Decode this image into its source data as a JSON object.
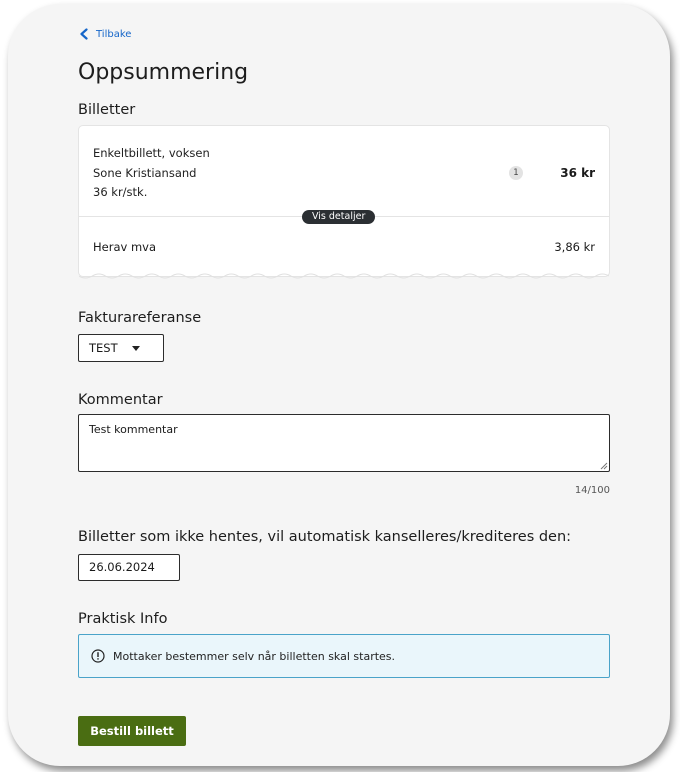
{
  "nav": {
    "back_label": "Tilbake"
  },
  "page": {
    "title": "Oppsummering"
  },
  "tickets": {
    "heading": "Billetter",
    "item": {
      "name": "Enkeltbillett, voksen",
      "zone": "Sone Kristiansand",
      "unit_price": "36 kr/stk.",
      "quantity": "1",
      "total": "36 kr"
    },
    "details_label": "Vis detaljer",
    "vat_label": "Herav mva",
    "vat_value": "3,86 kr"
  },
  "invoice": {
    "heading": "Fakturareferanse",
    "selected": "TEST"
  },
  "comment": {
    "heading": "Kommentar",
    "value": "Test kommentar",
    "counter": "14/100"
  },
  "cancellation": {
    "heading": "Billetter som ikke hentes, vil automatisk kanselleres/krediteres den:",
    "date": "26.06.2024"
  },
  "info": {
    "heading": "Praktisk Info",
    "message": "Mottaker bestemmer selv når billetten skal startes."
  },
  "actions": {
    "order_label": "Bestill billett"
  },
  "colors": {
    "accent_link": "#1666c9",
    "primary_button": "#4a6d12",
    "info_border": "#4aa3c9",
    "info_background": "#eaf6fb"
  },
  "icons": {
    "back": "chevron-left-icon",
    "dropdown": "caret-down-icon",
    "info": "info-circle-icon",
    "resize": "resize-handle-icon"
  }
}
